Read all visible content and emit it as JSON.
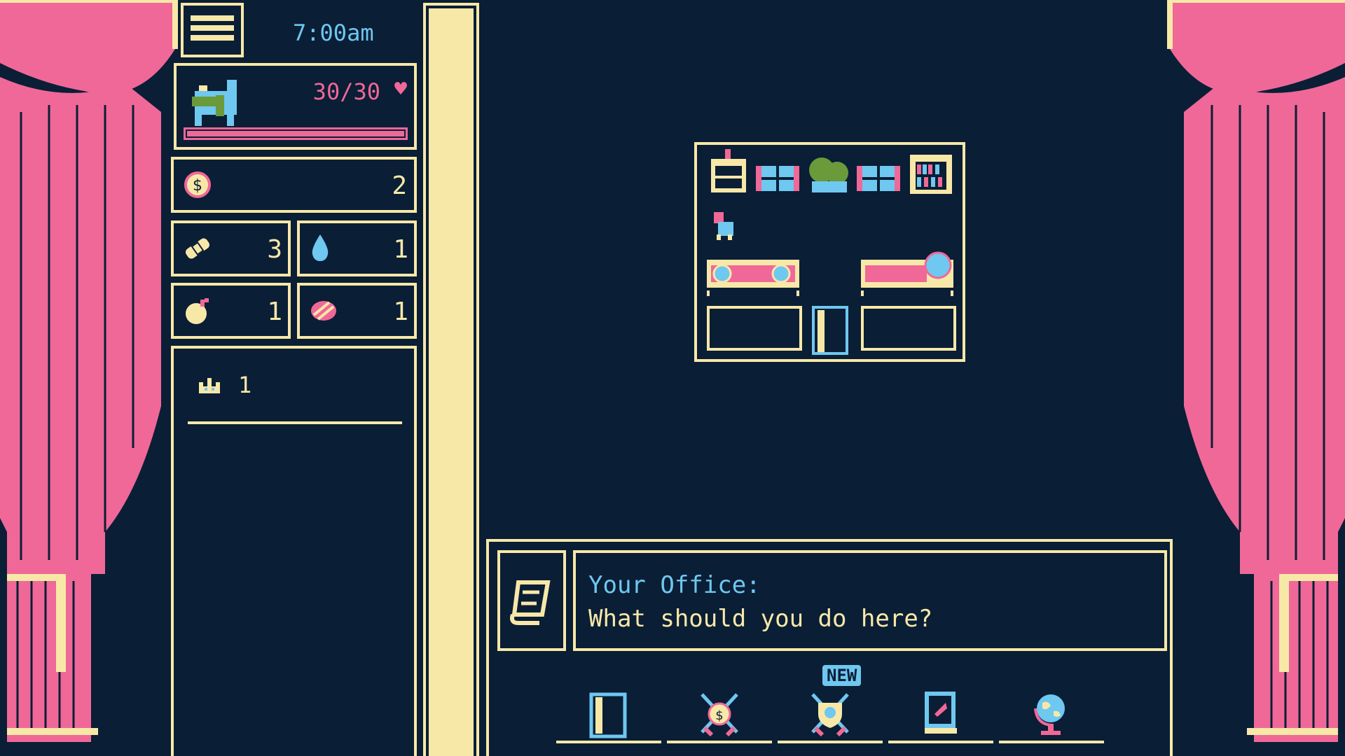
{
  "clock": {
    "time": "7:00am"
  },
  "player": {
    "hp": "30/30",
    "hp_fraction": 1.0
  },
  "resources": {
    "coins": "2",
    "bandages": "3",
    "water": "1",
    "bombs": "1",
    "food": "1"
  },
  "crown_count": "1",
  "dialog": {
    "title": "Your Office:",
    "prompt": "What should you do here?"
  },
  "actions": {
    "new_badge": "NEW",
    "items": [
      "door-icon",
      "coin-shield-icon",
      "crest-shield-icon",
      "book-icon",
      "globe-icon"
    ]
  },
  "colors": {
    "background": "#0a1e36",
    "cream": "#f8e8a8",
    "pink": "#f06898",
    "blue": "#6ec8f0",
    "green": "#6a9a3a"
  }
}
